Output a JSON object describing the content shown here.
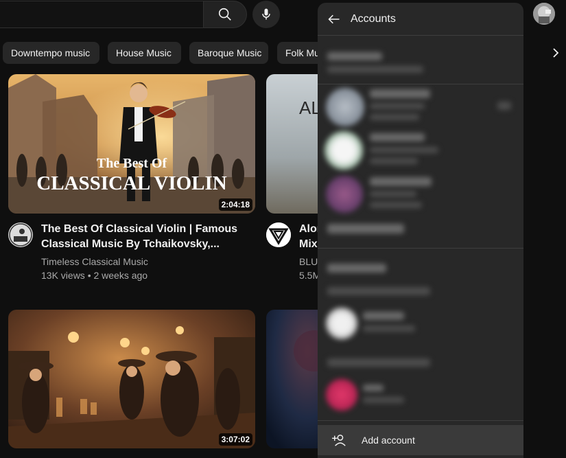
{
  "search": {
    "search_icon": "search-icon",
    "mic_icon": "mic-icon"
  },
  "chips": [
    {
      "label": "Downtempo music"
    },
    {
      "label": "House Music"
    },
    {
      "label": "Baroque Music"
    },
    {
      "label": "Folk Mu"
    }
  ],
  "videos": [
    {
      "thumb_text_1": "The Best Of",
      "thumb_text_2": "CLASSICAL VIOLIN",
      "duration": "2:04:18",
      "title_line1": "The Best Of Classical Violin | Famous",
      "title_line2": "Classical Music By Tchaikovsky,...",
      "channel": "Timeless Classical Music",
      "stats": "13K views • 2 weeks ago"
    },
    {
      "thumb_text": "AL",
      "title_line1": "Alor",
      "title_line2": "Mix",
      "channel": "BLUI",
      "stats": "5.5M"
    },
    {
      "duration": "3:07:02"
    }
  ],
  "accounts_panel": {
    "title": "Accounts",
    "add_account_label": "Add account"
  },
  "colors": {
    "background": "#0f0f0f",
    "panel": "#282828",
    "chip": "#272727",
    "meta_text": "#aaaaaa"
  }
}
